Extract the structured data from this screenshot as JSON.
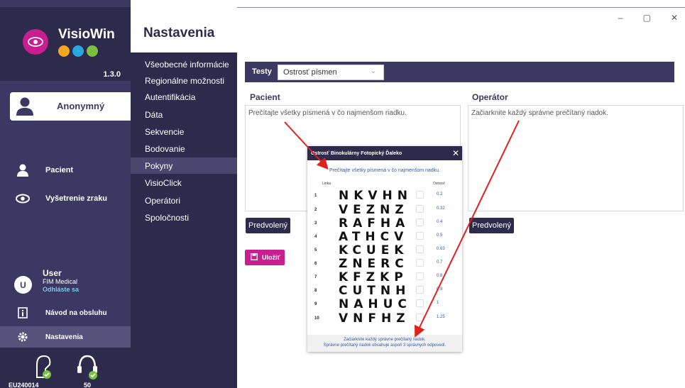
{
  "app": {
    "name": "VisioWin",
    "version": "1.3.0",
    "logo_colors": [
      "#f5a623",
      "#29a8e0",
      "#7bc142"
    ]
  },
  "window": {
    "controls": [
      "–",
      "▢",
      "✕"
    ]
  },
  "sidebar": {
    "user_profile": "Anonymný",
    "items": [
      {
        "label": "Pacient",
        "icon": "person-icon"
      },
      {
        "label": "Vyšetrenie zraku",
        "icon": "eye-icon"
      }
    ],
    "user": {
      "initial": "U",
      "name": "User",
      "company": "FIM Medical",
      "logout": "Odhláste sa"
    },
    "manual": "Návod na obsluhu",
    "settings": "Nastavenia",
    "device": {
      "serial": "EU240014",
      "count": "50"
    }
  },
  "page": {
    "title": "Nastavenia",
    "menu": [
      "Všeobecné informácie",
      "Regionálne možnosti",
      "Autentifikácia",
      "Dáta",
      "Sekvencie",
      "Bodovanie",
      "Pokyny",
      "VisioClick",
      "Operátori",
      "Spoločnosti"
    ],
    "active_menu": "Pokyny"
  },
  "tests": {
    "label": "Testy",
    "selected": "Ostrosť písmen"
  },
  "patient": {
    "label": "Pacient",
    "text": "Prečítajte všetky písmená v čo najmenšom riadku.",
    "default_button": "Predvolený"
  },
  "operator": {
    "label": "Operátor",
    "text": "Začiarknite každý správne prečítaný riadok.",
    "default_button": "Predvolený"
  },
  "save_button": "Uložiť",
  "popup": {
    "title": "Ostrosť Binokulárny Fotopický Ďaleko",
    "close": "✕",
    "instruction": "Prečítajte všetky písmená v čo najmenšom riadku.",
    "col_line": "Linka",
    "col_acuity": "Ostrosť",
    "rows": [
      {
        "num": "1",
        "letters": "NKVHN",
        "acuity": "0.2"
      },
      {
        "num": "2",
        "letters": "VEZNZ",
        "acuity": "0.32"
      },
      {
        "num": "3",
        "letters": "RAFHA",
        "acuity": "0.4"
      },
      {
        "num": "4",
        "letters": "ATHCV",
        "acuity": "0.5"
      },
      {
        "num": "5",
        "letters": "KCUEK",
        "acuity": "0.63"
      },
      {
        "num": "6",
        "letters": "ZNERC",
        "acuity": "0.7"
      },
      {
        "num": "7",
        "letters": "KFZKP",
        "acuity": "0.8"
      },
      {
        "num": "8",
        "letters": "CUTNH",
        "acuity": "0.9"
      },
      {
        "num": "9",
        "letters": "NAHUC",
        "acuity": "1"
      },
      {
        "num": "10",
        "letters": "VNFHZ",
        "acuity": "1.25"
      }
    ],
    "footer_line1": "Začiarknite každý správne prečítaný riadok.",
    "footer_line2": "Správne prečítaný riadok obsahuje aspoň 3 správnych odpovedí."
  },
  "colors": {
    "sidebar": "#3d3863",
    "sidebar_dark": "#2e2a4c",
    "accent": "#c81e8f",
    "annotation_arrow": "#e0201f"
  }
}
